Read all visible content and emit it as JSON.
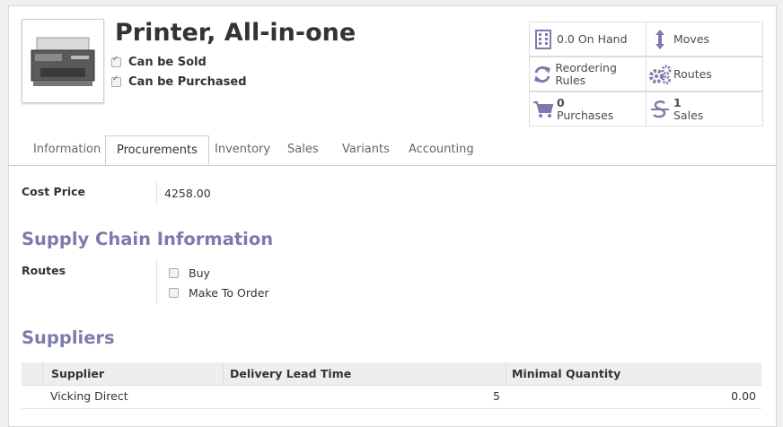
{
  "product": {
    "name": "Printer, All-in-one",
    "can_be_sold": "Can be Sold",
    "can_be_purchased": "Can be Purchased"
  },
  "stat_buttons": {
    "on_hand": "0.0 On Hand",
    "moves": "Moves",
    "reordering_rules": "Reordering Rules",
    "routes": "Routes",
    "purchases_count": "0",
    "purchases_label": "Purchases",
    "sales_count": "1",
    "sales_label": "Sales"
  },
  "tabs": [
    "Information",
    "Procurements",
    "Inventory",
    "Sales",
    "Variants",
    "Accounting"
  ],
  "active_tab": "Procurements",
  "procurements": {
    "cost_price_label": "Cost Price",
    "cost_price_value": "4258.00",
    "supply_chain_heading": "Supply Chain Information",
    "routes_label": "Routes",
    "route_options": [
      "Buy",
      "Make To Order"
    ],
    "suppliers_heading": "Suppliers"
  },
  "suppliers_table": {
    "columns": [
      "Supplier",
      "Delivery Lead Time",
      "Minimal Quantity"
    ],
    "rows": [
      {
        "supplier": "Vicking Direct",
        "lead_time": "5",
        "min_qty": "0.00"
      }
    ]
  },
  "colors": {
    "accent": "#7c7bad",
    "text": "#4c4c4c"
  },
  "icons": [
    "product-image",
    "building-icon",
    "arrows-vertical-icon",
    "refresh-icon",
    "cogs-icon",
    "cart-icon",
    "strikethrough-s-icon"
  ]
}
